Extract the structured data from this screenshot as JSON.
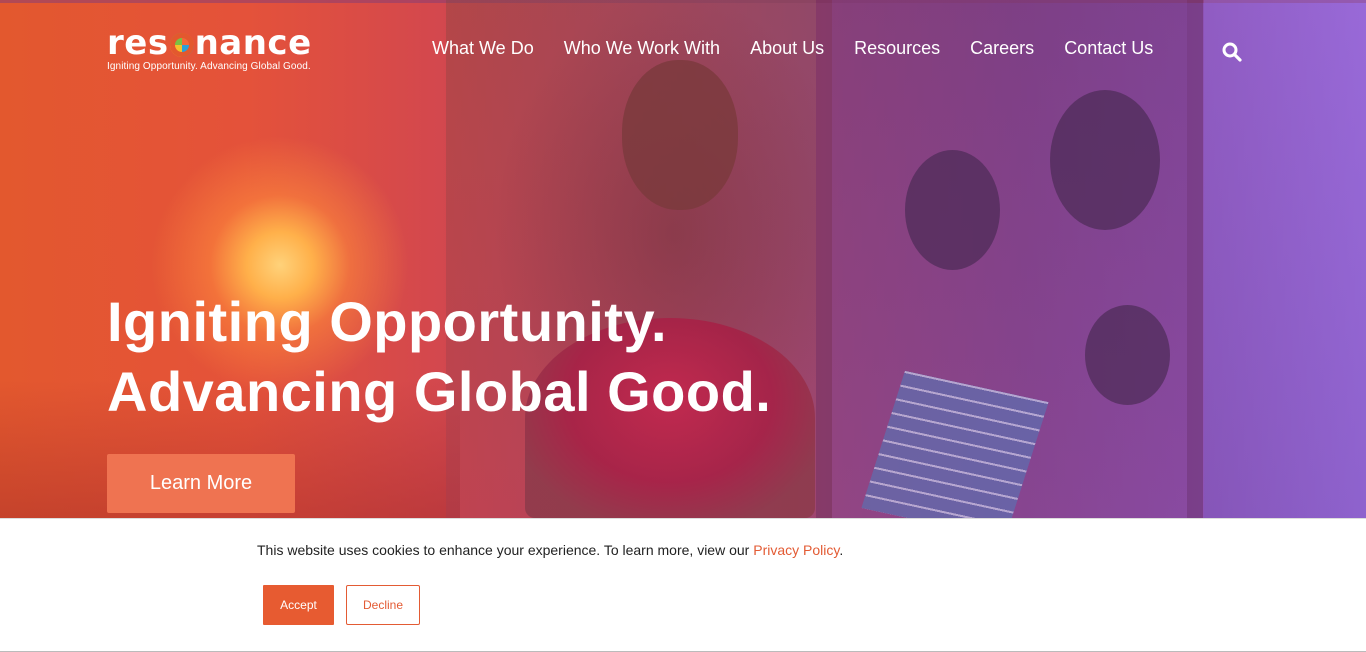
{
  "brand": {
    "name_part1": "res",
    "name_part2": "nance",
    "tagline": "Igniting Opportunity. Advancing Global Good."
  },
  "nav": {
    "items": [
      {
        "label": "What We Do"
      },
      {
        "label": "Who We Work With"
      },
      {
        "label": "About Us"
      },
      {
        "label": "Resources"
      },
      {
        "label": "Careers"
      },
      {
        "label": "Contact Us"
      }
    ],
    "search_icon": "search-icon"
  },
  "hero": {
    "headline_line1": "Igniting Opportunity.",
    "headline_line2": "Advancing Global Good.",
    "cta_label": "Learn More"
  },
  "cookie_banner": {
    "text": "This website uses cookies to enhance your experience. To learn more, view our ",
    "link_text": "Privacy Policy",
    "text_end": ".",
    "accept_label": "Accept",
    "decline_label": "Decline"
  },
  "colors": {
    "accent": "#e75b31",
    "cta": "#ef7351"
  }
}
